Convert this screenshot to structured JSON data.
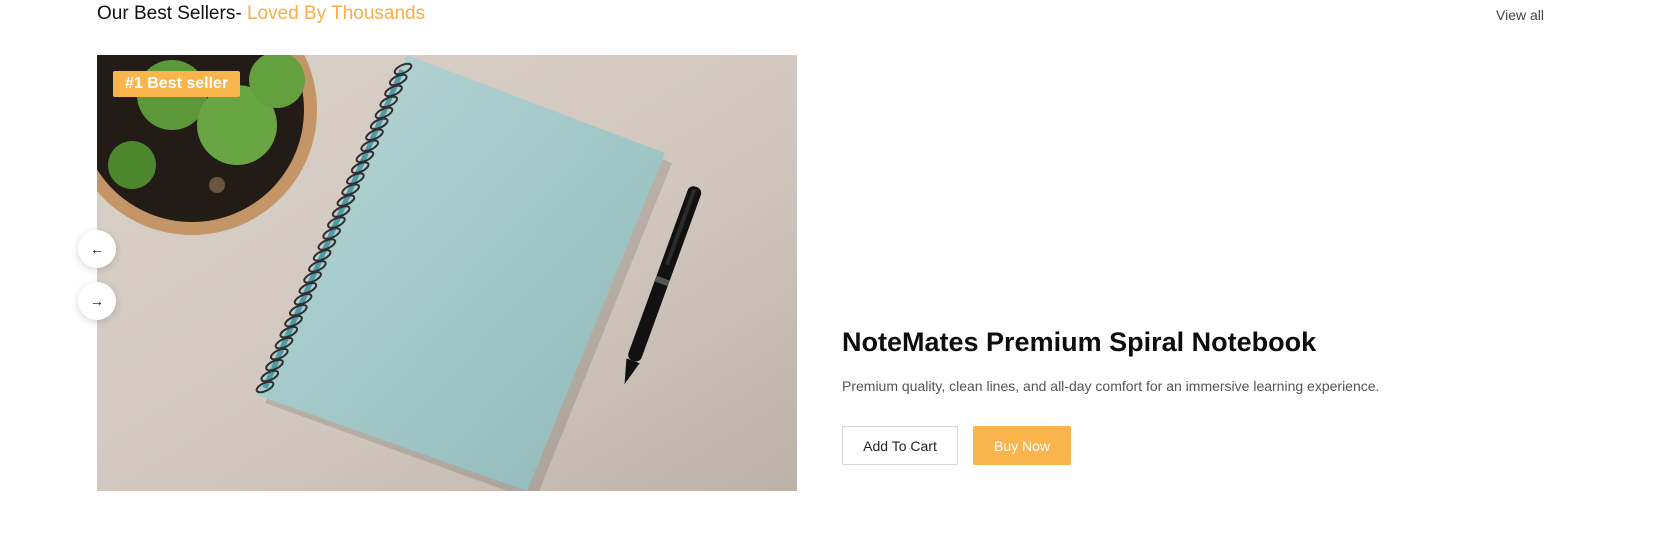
{
  "section": {
    "title_main": "Our Best Sellers-",
    "title_accent": "Loved By Thousands",
    "view_all_label": "View all"
  },
  "carousel": {
    "badge_label": "#1 Best seller",
    "prev_icon": "arrow-left-icon",
    "next_icon": "arrow-right-icon",
    "prev_glyph": "←",
    "next_glyph": "→"
  },
  "product": {
    "name": "NoteMates Premium Spiral Notebook",
    "description": "Premium quality, clean lines, and all-day comfort for an immersive learning experience.",
    "add_to_cart_label": "Add To Cart",
    "buy_now_label": "Buy Now"
  },
  "colors": {
    "accent": "#f7ae47",
    "button_primary": "#f9b44b",
    "notebook": "#a6cccc",
    "background_surface": "#d8cfc7"
  }
}
